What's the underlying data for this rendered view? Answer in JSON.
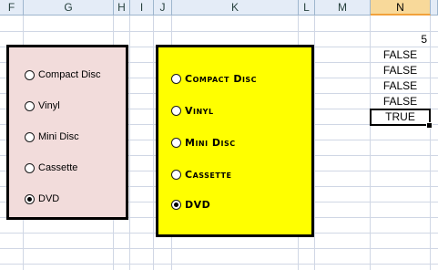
{
  "columns": [
    {
      "label": "F"
    },
    {
      "label": "G"
    },
    {
      "label": "H"
    },
    {
      "label": "I"
    },
    {
      "label": "J"
    },
    {
      "label": "K"
    },
    {
      "label": "L"
    },
    {
      "label": "M"
    },
    {
      "label": "N",
      "active": true
    }
  ],
  "cells": {
    "n_index": "5",
    "n_values": [
      "FALSE",
      "FALSE",
      "FALSE",
      "FALSE",
      "TRUE"
    ]
  },
  "group1": {
    "background": "#f2dcdb",
    "options": [
      {
        "label": "Compact Disc",
        "checked": false
      },
      {
        "label": "Vinyl",
        "checked": false
      },
      {
        "label": "Mini Disc",
        "checked": false
      },
      {
        "label": "Cassette",
        "checked": false
      },
      {
        "label": "DVD",
        "checked": true
      }
    ]
  },
  "group2": {
    "background": "#ffff00",
    "options": [
      {
        "label": "Compact Disc",
        "checked": false
      },
      {
        "label": "Vinyl",
        "checked": false
      },
      {
        "label": "Mini Disc",
        "checked": false
      },
      {
        "label": "Cassette",
        "checked": false
      },
      {
        "label": "DVD",
        "checked": true
      }
    ]
  }
}
